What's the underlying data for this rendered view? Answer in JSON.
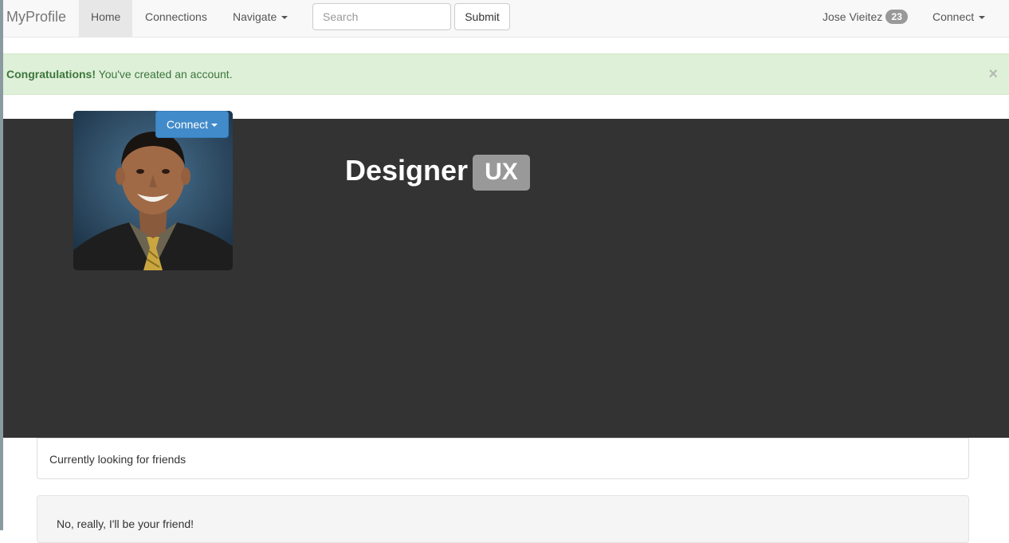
{
  "navbar": {
    "brand": "MyProfile",
    "home_label": "Home",
    "connections_label": "Connections",
    "navigate_label": "Navigate",
    "search_placeholder": "Search",
    "submit_label": "Submit",
    "user_name": "Jose Vieitez",
    "notification_count": "23",
    "connect_label": "Connect"
  },
  "alert": {
    "strong_text": "Congratulations!",
    "message": " You've created an account.",
    "close_symbol": "×"
  },
  "hero": {
    "connect_button_label": "Connect",
    "title": "Designer",
    "label": "UX",
    "background_color": "#333333"
  },
  "panel": {
    "text": "Currently looking for friends"
  },
  "well": {
    "text": "No, really, I'll be your friend!"
  },
  "colors": {
    "primary": "#428bca",
    "alert_bg": "#dff0d8",
    "alert_text": "#3c763d",
    "label_gray": "#999999"
  }
}
